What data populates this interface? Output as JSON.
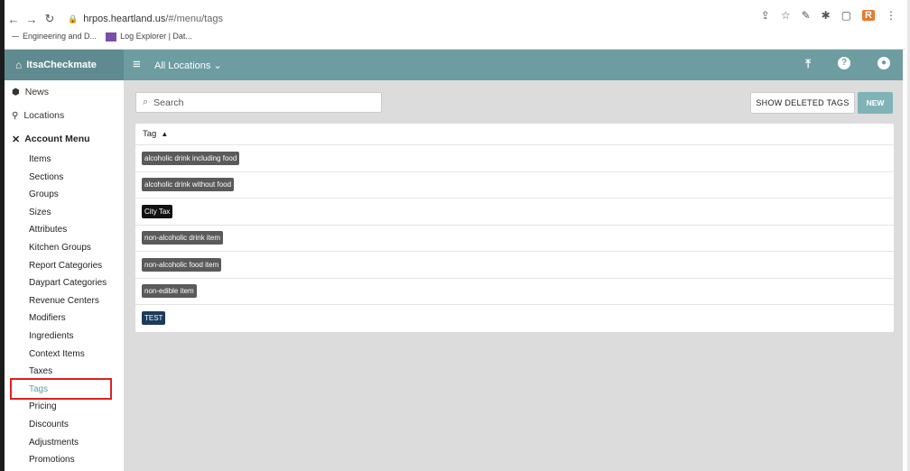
{
  "browser": {
    "url_host": "hrpos.heartland.us",
    "url_path": "/#/menu/tags",
    "bookmarks": [
      "Engineering and D...",
      "Log Explorer | Dat..."
    ],
    "ext_label": "R"
  },
  "topbar": {
    "brand": "ItsaCheckmate",
    "location_selector": "All Locations"
  },
  "sidebar": {
    "news": "News",
    "locations": "Locations",
    "account_menu": "Account Menu",
    "items": [
      {
        "label": "Items"
      },
      {
        "label": "Sections"
      },
      {
        "label": "Groups"
      },
      {
        "label": "Sizes"
      },
      {
        "label": "Attributes"
      },
      {
        "label": "Kitchen Groups"
      },
      {
        "label": "Report Categories"
      },
      {
        "label": "Daypart Categories"
      },
      {
        "label": "Revenue Centers"
      },
      {
        "label": "Modifiers"
      },
      {
        "label": "Ingredients"
      },
      {
        "label": "Context Items"
      },
      {
        "label": "Taxes"
      },
      {
        "label": "Tags",
        "active": true
      },
      {
        "label": "Pricing"
      },
      {
        "label": "Discounts"
      },
      {
        "label": "Adjustments"
      },
      {
        "label": "Promotions"
      }
    ]
  },
  "main": {
    "search_placeholder": "Search",
    "show_deleted_label": "SHOW DELETED TAGS",
    "new_label": "NEW",
    "table_header": "Tag",
    "tags": [
      {
        "label": "alcoholic drink including food",
        "color": "#5a5a5a"
      },
      {
        "label": "alcoholic drink without food",
        "color": "#5a5a5a"
      },
      {
        "label": "City Tax",
        "color": "#111111"
      },
      {
        "label": "non-alcoholic drink item",
        "color": "#5a5a5a"
      },
      {
        "label": "non-alcoholic food item",
        "color": "#5a5a5a"
      },
      {
        "label": "non-edible item",
        "color": "#5a5a5a"
      },
      {
        "label": "TEST",
        "color": "#1c3a5c"
      }
    ]
  },
  "colors": {
    "topbar": "#6d9ca1",
    "brand_bg": "#5f8b90",
    "new_button": "#7fb3b8",
    "active_item": "#5f9ea0",
    "highlight_box": "#e02020"
  }
}
